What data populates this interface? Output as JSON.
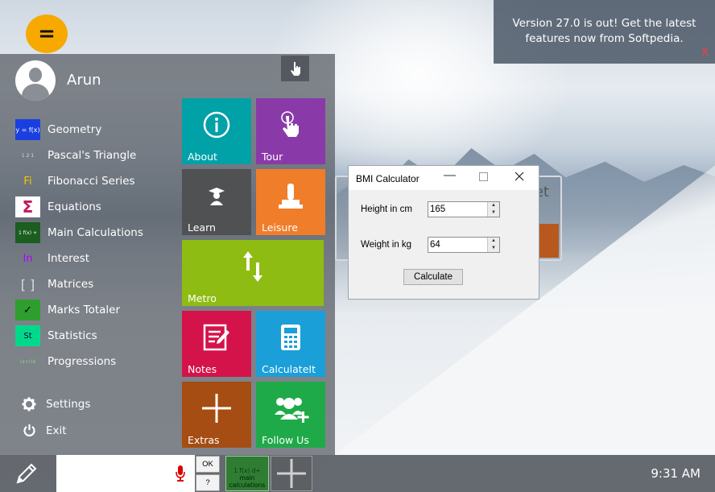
{
  "app": {
    "menu_button_label": "=",
    "username": "Arun"
  },
  "notification": {
    "line1": "Version 27.0 is out! Get the latest",
    "line2": "features now from Softpedia.",
    "close_label": "X"
  },
  "menu": {
    "items": [
      {
        "label": "Geometry",
        "icon": "geometry-icon",
        "icon_text": "y = f(x)",
        "color": "#1a3fe0"
      },
      {
        "label": "Pascal's Triangle",
        "icon": "pascal-triangle-icon",
        "icon_text": "1 2 1",
        "color": "#6b6f75"
      },
      {
        "label": "Fibonacci Series",
        "icon": "fibonacci-icon",
        "icon_text": "Fi",
        "color": "#f7c600"
      },
      {
        "label": "Equations",
        "icon": "sigma-icon",
        "icon_text": "Σ",
        "color": "#c2185b"
      },
      {
        "label": "Main Calculations",
        "icon": "calculations-icon",
        "icon_text": "1 f(x) +",
        "color": "#1b5e20"
      },
      {
        "label": "Interest",
        "icon": "interest-icon",
        "icon_text": "In",
        "color": "#b100ff"
      },
      {
        "label": "Matrices",
        "icon": "matrix-icon",
        "icon_text": "[ ]",
        "color": "#6b6f75"
      },
      {
        "label": "Marks Totaler",
        "icon": "checkmark-icon",
        "icon_text": "✓",
        "color": "#2e9e2e"
      },
      {
        "label": "Statistics",
        "icon": "statistics-icon",
        "icon_text": "St",
        "color": "#00d98b"
      },
      {
        "label": "Progressions",
        "icon": "progressions-icon",
        "icon_text": "(a+r)d",
        "color": "#1b5e20"
      }
    ],
    "settings_label": "Settings",
    "exit_label": "Exit"
  },
  "tiles": {
    "about": {
      "label": "About",
      "color": "#00a1a7"
    },
    "tour": {
      "label": "Tour",
      "color": "#8a3aa8"
    },
    "learn": {
      "label": "Learn",
      "color": "#4f5153"
    },
    "leisure": {
      "label": "Leisure",
      "color": "#f07d2a"
    },
    "metro": {
      "label": "Metro",
      "color": "#8fbc13"
    },
    "notes": {
      "label": "Notes",
      "color": "#d4134a"
    },
    "calculateit": {
      "label": "CalculateIt",
      "color": "#1a9fd8"
    },
    "extras": {
      "label": "Extras",
      "color": "#a54d12"
    },
    "follow_us": {
      "label": "Follow Us",
      "color": "#1eaa48"
    }
  },
  "widget_behind": {
    "partial_text": "et"
  },
  "bmi_window": {
    "title": "BMI Calculator",
    "height_label": "Height in cm",
    "height_value": "165",
    "weight_label": "Weight in kg",
    "weight_value": "64",
    "calculate_label": "Calculate"
  },
  "taskbar": {
    "input_value": "",
    "ok_label": "OK",
    "help_label": "?",
    "app1_top": "1 f(x) d+",
    "app1_label": "main calculations",
    "time": "9:31 AM"
  }
}
